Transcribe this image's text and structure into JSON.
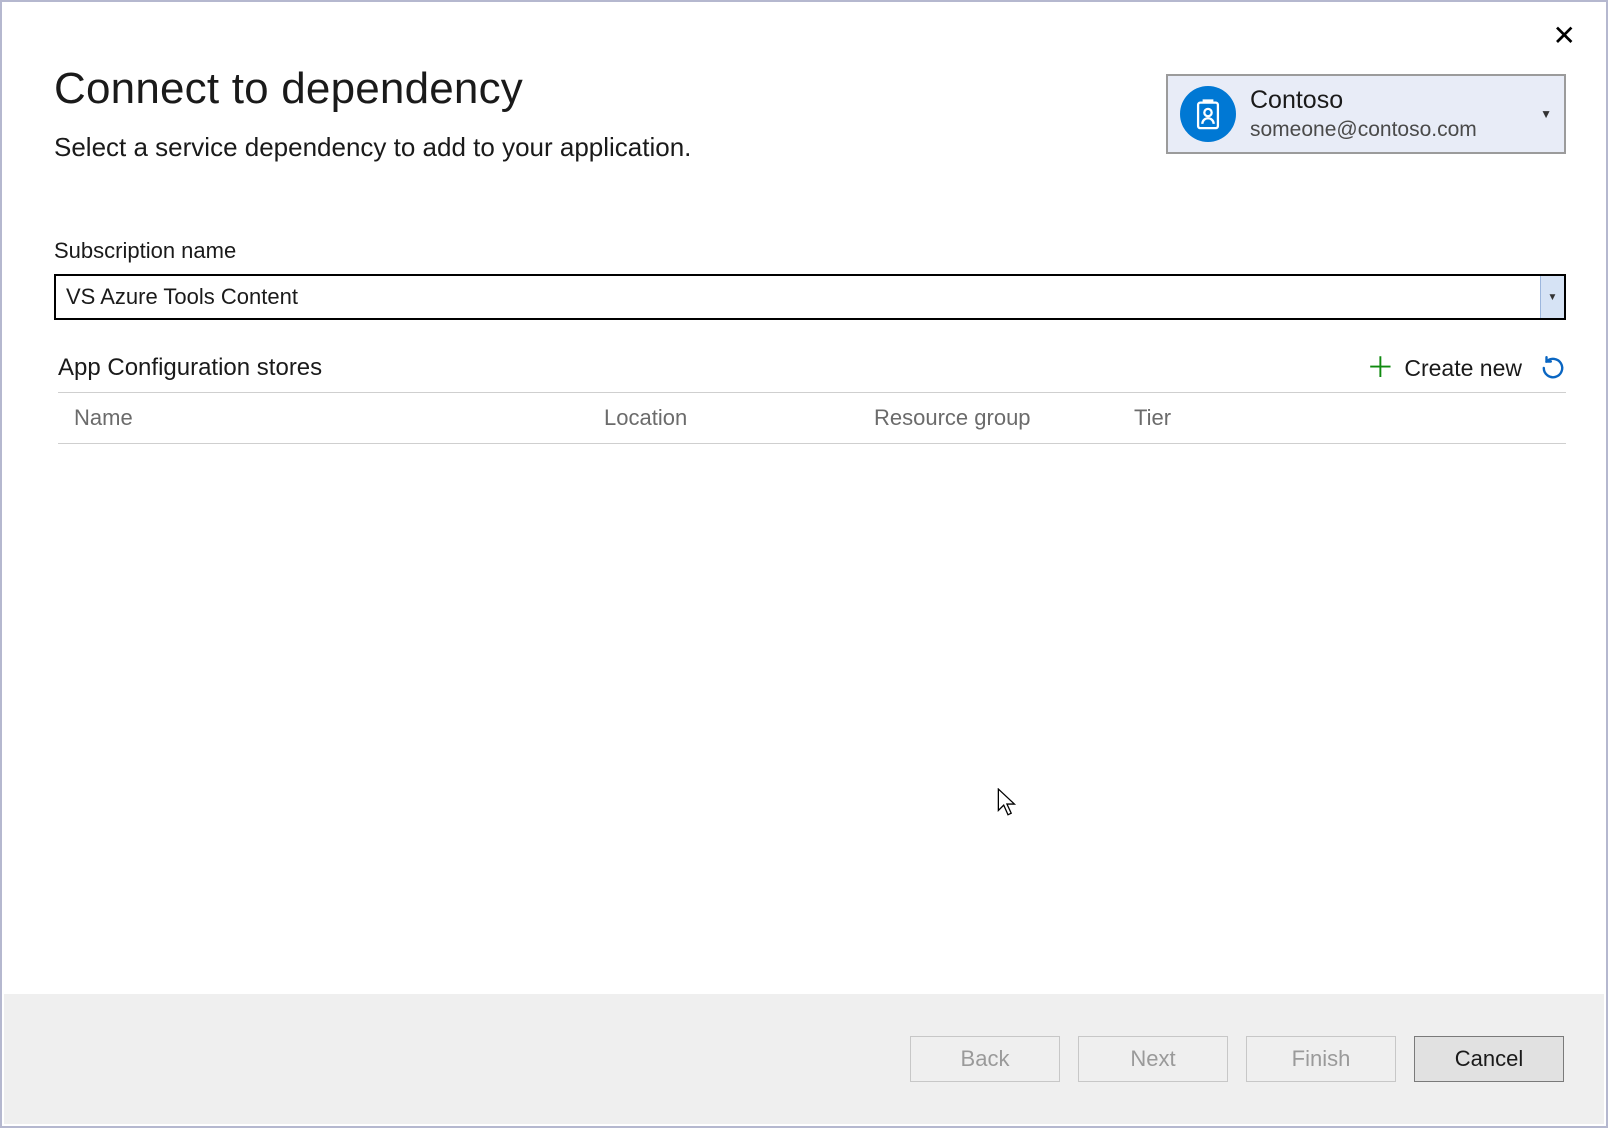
{
  "dialog": {
    "title": "Connect to dependency",
    "subtitle": "Select a service dependency to add to your application."
  },
  "account": {
    "name": "Contoso",
    "email": "someone@contoso.com"
  },
  "subscription": {
    "label": "Subscription name",
    "value": "VS Azure Tools Content"
  },
  "stores": {
    "section_label": "App Configuration stores",
    "create_new_label": "Create new",
    "columns": {
      "name": "Name",
      "location": "Location",
      "resource_group": "Resource group",
      "tier": "Tier"
    },
    "rows": []
  },
  "footer": {
    "back": "Back",
    "next": "Next",
    "finish": "Finish",
    "cancel": "Cancel"
  }
}
